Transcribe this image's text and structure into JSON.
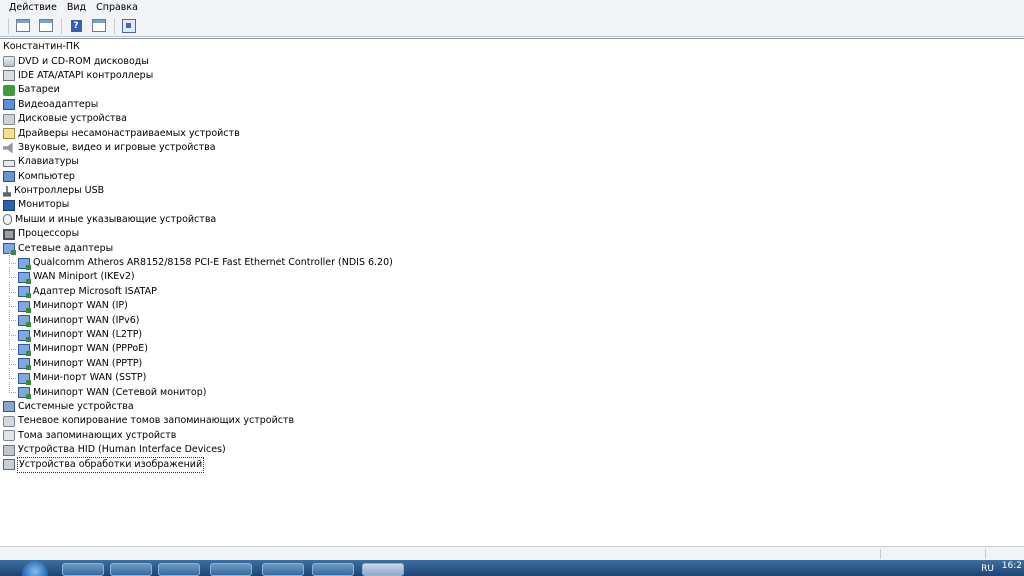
{
  "menu": [
    "Действие",
    "Вид",
    "Справка"
  ],
  "toolbar": {
    "icons": [
      "properties-icon",
      "update-driver-icon",
      "help-icon",
      "show-hidden-icon",
      "scan-hardware-icon"
    ]
  },
  "tree": {
    "root": "Константин-ПК",
    "categories_before": [
      {
        "label": "DVD и CD-ROM дисководы",
        "icon": "dvd-drive-icon"
      },
      {
        "label": "IDE ATA/ATAPI контроллеры",
        "icon": "ide-controller-icon"
      },
      {
        "label": "Батареи",
        "icon": "battery-icon"
      },
      {
        "label": "Видеоадаптеры",
        "icon": "display-adapter-icon"
      },
      {
        "label": "Дисковые устройства",
        "icon": "disk-drive-icon"
      },
      {
        "label": "Драйверы несамонастраиваемых устройств",
        "icon": "non-pnp-driver-icon"
      },
      {
        "label": "Звуковые, видео и игровые устройства",
        "icon": "sound-icon"
      },
      {
        "label": "Клавиатуры",
        "icon": "keyboard-icon"
      },
      {
        "label": "Компьютер",
        "icon": "computer-icon"
      },
      {
        "label": "Контроллеры USB",
        "icon": "usb-icon"
      },
      {
        "label": "Мониторы",
        "icon": "monitor-icon"
      },
      {
        "label": "Мыши и иные указывающие устройства",
        "icon": "mouse-icon"
      },
      {
        "label": "Процессоры",
        "icon": "cpu-icon"
      },
      {
        "label": "Сетевые адаптеры",
        "icon": "network-adapter-icon"
      }
    ],
    "network_children": [
      "Qualcomm Atheros AR8152/8158 PCI-E Fast Ethernet Controller (NDIS 6.20)",
      "WAN Miniport (IKEv2)",
      "Адаптер Microsoft ISATAP",
      "Минипорт WAN (IP)",
      "Минипорт WAN (IPv6)",
      "Минипорт WAN (L2TP)",
      "Минипорт WAN (PPPoE)",
      "Минипорт WAN (PPTP)",
      "Мини-порт WAN (SSTP)",
      "Минипорт WAN (Сетевой монитор)"
    ],
    "categories_after": [
      {
        "label": "Системные устройства",
        "icon": "system-device-icon"
      },
      {
        "label": "Теневое копирование томов запоминающих устройств",
        "icon": "shadow-copy-icon"
      },
      {
        "label": "Тома запоминающих устройств",
        "icon": "storage-volume-icon"
      },
      {
        "label": "Устройства HID (Human Interface Devices)",
        "icon": "hid-icon"
      },
      {
        "label": "Устройства обработки изображений",
        "icon": "imaging-device-icon",
        "selected": true
      }
    ]
  },
  "taskbar": {
    "tray_text": "RU",
    "clock": "16:2"
  }
}
